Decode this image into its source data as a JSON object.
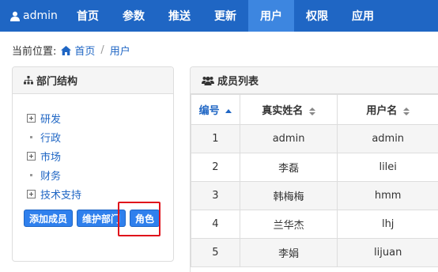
{
  "navbar": {
    "brand": "admin",
    "items": [
      {
        "label": "首页"
      },
      {
        "label": "参数"
      },
      {
        "label": "推送"
      },
      {
        "label": "更新"
      },
      {
        "label": "用户"
      },
      {
        "label": "权限"
      },
      {
        "label": "应用"
      }
    ],
    "active_index": 4,
    "color": "#1f66c4",
    "active_color": "#3d86e0"
  },
  "breadcrumb": {
    "prefix": "当前位置:",
    "home": "首页",
    "separator": "/",
    "current": "用户"
  },
  "dept_panel": {
    "title": "部门结构",
    "tree": [
      {
        "label": "研发",
        "expandable": true
      },
      {
        "label": "行政",
        "expandable": false
      },
      {
        "label": "市场",
        "expandable": true
      },
      {
        "label": "财务",
        "expandable": false
      },
      {
        "label": "技术支持",
        "expandable": true
      }
    ],
    "buttons": {
      "add_member": "添加成员",
      "maintain_dept": "维护部门",
      "role": "角色"
    }
  },
  "members_panel": {
    "title": "成员列表",
    "columns": [
      {
        "label": "编号",
        "sort": "asc"
      },
      {
        "label": "真实姓名",
        "sort": "both"
      },
      {
        "label": "用户名",
        "sort": "both"
      }
    ],
    "rows": [
      {
        "id": "1",
        "name": "admin",
        "username": "admin"
      },
      {
        "id": "2",
        "name": "李磊",
        "username": "lilei"
      },
      {
        "id": "3",
        "name": "韩梅梅",
        "username": "hmm"
      },
      {
        "id": "4",
        "name": "兰华杰",
        "username": "lhj"
      },
      {
        "id": "5",
        "name": "李娟",
        "username": "lijuan"
      }
    ]
  }
}
